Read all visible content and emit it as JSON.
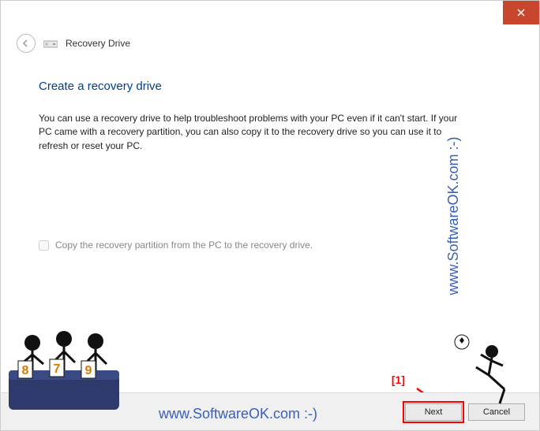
{
  "window": {
    "header_title": "Recovery Drive"
  },
  "content": {
    "heading": "Create a recovery drive",
    "body": "You can use a recovery drive to help troubleshoot problems with your PC even if it can't start. If your PC came with a recovery partition, you can also copy it to the recovery drive so you can use it to refresh or reset your PC.",
    "checkbox_label": "Copy the recovery partition from the PC to the recovery drive."
  },
  "footer": {
    "next_label": "Next",
    "cancel_label": "Cancel"
  },
  "annotation": {
    "marker": "[1]"
  },
  "watermark": {
    "text": "www.SoftwareOK.com :-)"
  }
}
